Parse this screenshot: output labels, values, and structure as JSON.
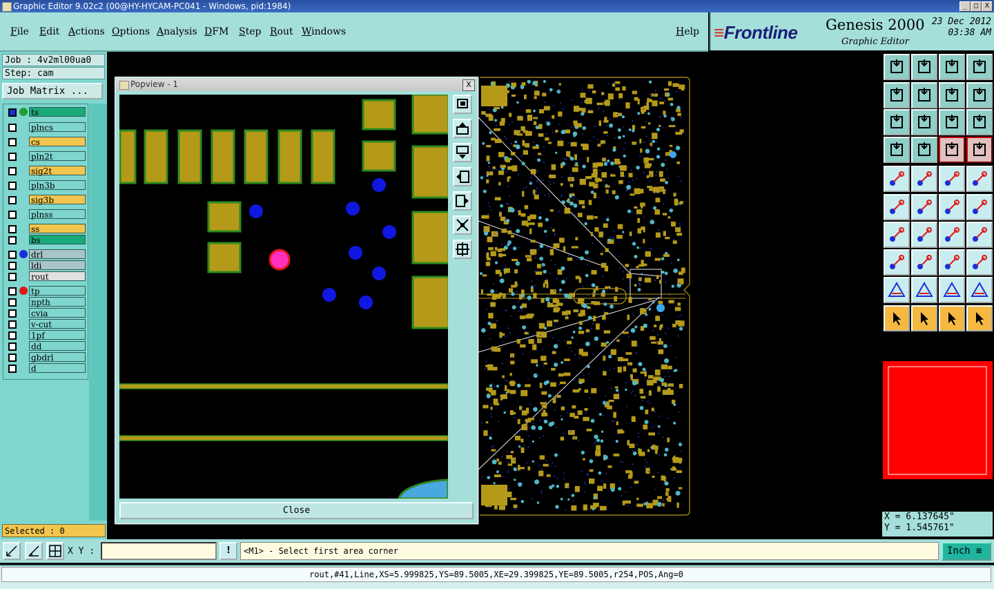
{
  "window": {
    "title": "Graphic Editor 9.02c2 (00@HY-HYCAM-PC041 - Windows, pid:1984)",
    "controls": [
      "_",
      "□",
      "X"
    ]
  },
  "menu": [
    "File",
    "Edit",
    "Actions",
    "Options",
    "Analysis",
    "DFM",
    "Step",
    "Rout",
    "Windows"
  ],
  "help_label": "Help",
  "brand": {
    "logo_text": "Frontline",
    "product": "Genesis 2000",
    "subtitle": "Graphic Editor",
    "date": "23 Dec 2012",
    "time": "03:38 AM"
  },
  "job": {
    "job_label": "Job : 4v2ml00ua0",
    "step_label": "Step: cam",
    "matrix_button": "Job Matrix ..."
  },
  "layers": [
    {
      "name": "ts",
      "color": "#1aa97a",
      "dot": "#1e9e2e",
      "active": true
    },
    {
      "name": "plncs",
      "color": "#7fd6cf"
    },
    {
      "name": "cs",
      "color": "#f2c54e"
    },
    {
      "name": "pln2t",
      "color": "#7fd6cf"
    },
    {
      "name": "sig2t",
      "color": "#f2c54e"
    },
    {
      "name": "pln3b",
      "color": "#7fd6cf"
    },
    {
      "name": "sig3b",
      "color": "#f2c54e"
    },
    {
      "name": "plnss",
      "color": "#7fd6cf"
    },
    {
      "name": "ss",
      "color": "#f2c54e"
    },
    {
      "name": "bs",
      "color": "#1aa97a"
    },
    {
      "name": "drl",
      "color": "#a9c5c9",
      "dot": "#1830d8"
    },
    {
      "name": "ldi",
      "color": "#a9c5c9"
    },
    {
      "name": "rout",
      "color": "#e0e0e0"
    },
    {
      "name": "tp",
      "color": "#7fd6cf",
      "dot": "#e01818"
    },
    {
      "name": "npth",
      "color": "#7fd6cf"
    },
    {
      "name": "cvia",
      "color": "#7fd6cf"
    },
    {
      "name": "v-cut",
      "color": "#7fd6cf"
    },
    {
      "name": "1pf",
      "color": "#7fd6cf"
    },
    {
      "name": "dd",
      "color": "#7fd6cf"
    },
    {
      "name": "gbdrl",
      "color": "#7fd6cf"
    },
    {
      "name": "d",
      "color": "#7fd6cf"
    }
  ],
  "selected_label": "Selected : 0",
  "popview": {
    "title": "Popview - 1",
    "close_x": "X",
    "close_button": "Close"
  },
  "coords": {
    "x": "X  =  6.137645\"",
    "y": "Y  =  1.545761\""
  },
  "bottom": {
    "xy_label": "X Y :",
    "xy_value": "",
    "bang": "!",
    "prompt": "<M1> - Select first area corner",
    "unit": "Inch ≡"
  },
  "status": "rout,#41,Line,XS=5.999825,YS=89.5005,XE=29.399825,YE=89.5005,r254,POS,Ang=0",
  "colors": {
    "panel": "#a5dfda",
    "pad": "#b59a1a",
    "pad_border": "#2e8a1e",
    "drill": "#1018e0",
    "hole_highlight": "#ff2fc0"
  }
}
